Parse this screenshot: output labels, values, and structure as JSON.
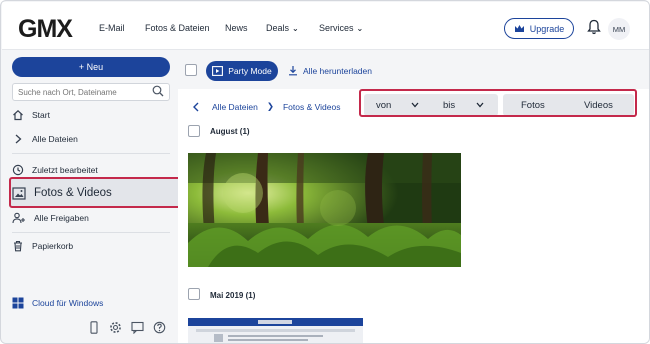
{
  "header": {
    "logo": "GMX",
    "nav": [
      "E-Mail",
      "Fotos & Dateien",
      "News",
      "Deals",
      "Services"
    ],
    "upgrade_label": "Upgrade",
    "avatar_initials": "MM"
  },
  "sidebar": {
    "new_label": "+ Neu",
    "search_placeholder": "Suche nach Ort, Dateiname",
    "items": [
      {
        "label": "Start",
        "icon": "home-icon"
      },
      {
        "label": "Alle Dateien",
        "icon": "chevron-right-icon"
      },
      {
        "label": "Zuletzt bearbeitet",
        "icon": "clock-icon"
      },
      {
        "label": "Fotos & Videos",
        "icon": "image-icon"
      },
      {
        "label": "Alle Freigaben",
        "icon": "share-users-icon"
      },
      {
        "label": "Papierkorb",
        "icon": "trash-icon"
      }
    ],
    "cloud_label": "Cloud für Windows"
  },
  "toolbar": {
    "party_label": "Party Mode",
    "download_label": "Alle herunterladen"
  },
  "breadcrumb": {
    "items": [
      "Alle Dateien",
      "Fotos & Videos"
    ]
  },
  "filters": {
    "from_label": "von",
    "to_label": "bis",
    "photos_label": "Fotos",
    "videos_label": "Videos"
  },
  "groups": [
    {
      "label": "August (1)"
    },
    {
      "label": "Mai 2019 (1)"
    }
  ],
  "colors": {
    "accent": "#1c449b",
    "highlight": "#c4294b"
  }
}
